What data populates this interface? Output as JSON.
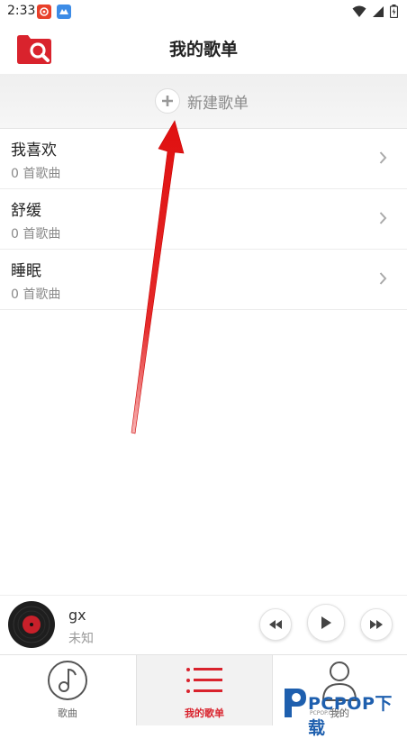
{
  "status_bar": {
    "time": "2:33",
    "icons": [
      "notification-app-icon",
      "game-app-icon",
      "wifi-icon",
      "signal-icon",
      "battery-icon"
    ]
  },
  "header": {
    "title": "我的歌单",
    "logo_icon": "folder-search-icon"
  },
  "new_playlist": {
    "label": "新建歌单",
    "icon": "plus-circle-icon"
  },
  "playlists": [
    {
      "name": "我喜欢",
      "count": "0 首歌曲"
    },
    {
      "name": "舒缓",
      "count": "0 首歌曲"
    },
    {
      "name": "睡眠",
      "count": "0 首歌曲"
    }
  ],
  "player": {
    "title": "gx",
    "artist": "未知"
  },
  "tabs": [
    {
      "label": "歌曲",
      "icon": "music-note-icon"
    },
    {
      "label": "我的歌单",
      "icon": "list-icon",
      "active": true
    },
    {
      "label": "我的",
      "icon": "person-icon"
    }
  ],
  "watermark": {
    "text": "PCPOP下载",
    "sub": "PCPOP.COM"
  },
  "colors": {
    "accent": "#d9232d",
    "muted_text": "#8a8a8a",
    "watermark": "#1e5fae"
  }
}
